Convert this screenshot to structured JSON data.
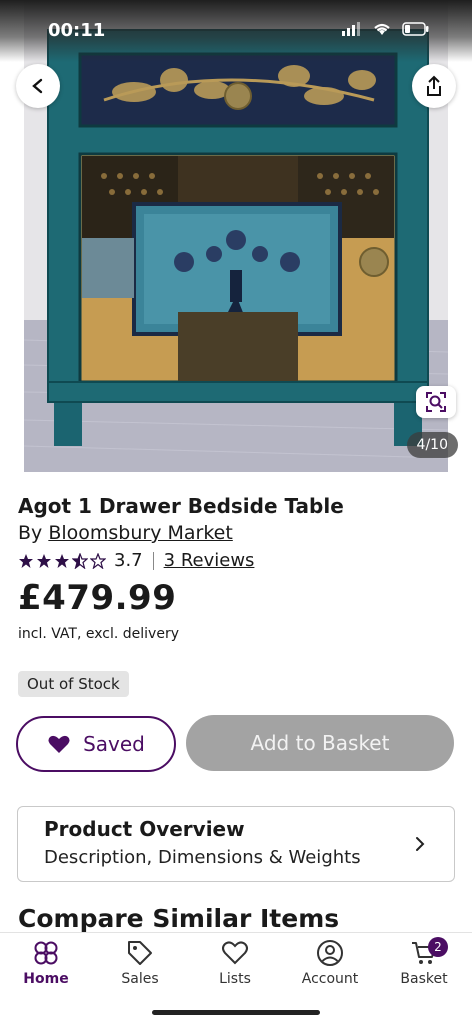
{
  "status_bar": {
    "time": "00:11"
  },
  "gallery": {
    "counter": "4/10"
  },
  "product": {
    "title": "Agot 1 Drawer Bedside Table",
    "by_prefix": "By",
    "brand": "Bloomsbury Market",
    "rating": "3.7",
    "rating_stars": 3.5,
    "reviews_link": "3 Reviews",
    "price": "£479.99",
    "vat_note": "incl. VAT, excl. delivery",
    "stock_status": "Out of Stock"
  },
  "actions": {
    "saved_label": "Saved",
    "add_to_basket_label": "Add to Basket"
  },
  "overview": {
    "title": "Product Overview",
    "subtitle": "Description, Dimensions & Weights"
  },
  "compare_heading": "Compare Similar Items",
  "bottom_nav": {
    "items": [
      {
        "label": "Home",
        "icon": "home-icon",
        "active": true
      },
      {
        "label": "Sales",
        "icon": "tag-icon"
      },
      {
        "label": "Lists",
        "icon": "heart-icon"
      },
      {
        "label": "Account",
        "icon": "account-icon"
      },
      {
        "label": "Basket",
        "icon": "cart-icon",
        "badge": "2"
      }
    ]
  },
  "colors": {
    "brand_purple": "#4b0d63",
    "disabled_button": "#a3a3a3",
    "cabinet_teal": "#1f6e78"
  }
}
